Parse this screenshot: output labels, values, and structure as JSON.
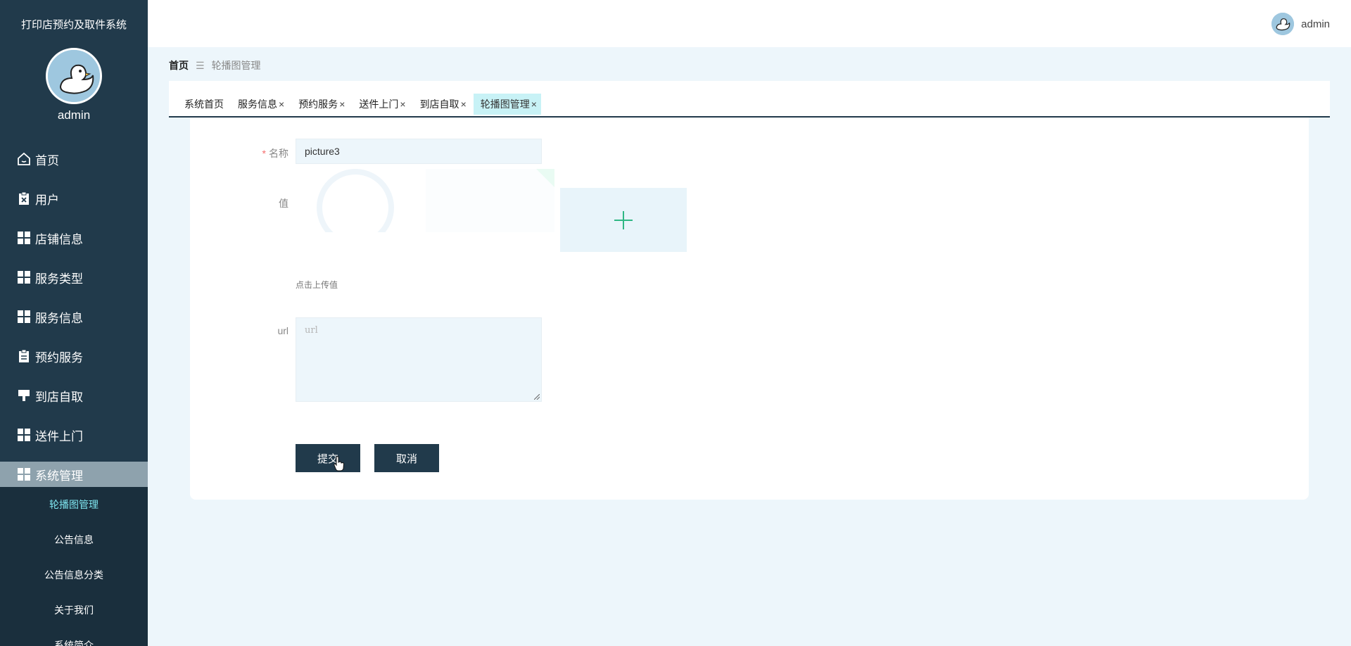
{
  "sidebar": {
    "brand": "打印店预约及取件系统",
    "username": "admin",
    "items": [
      {
        "label": "首页",
        "icon": "home-icon"
      },
      {
        "label": "用户",
        "icon": "clipboard-x-icon"
      },
      {
        "label": "店铺信息",
        "icon": "grid-icon"
      },
      {
        "label": "服务类型",
        "icon": "grid-icon"
      },
      {
        "label": "服务信息",
        "icon": "grid-icon"
      },
      {
        "label": "预约服务",
        "icon": "clipboard-icon"
      },
      {
        "label": "到店自取",
        "icon": "stamp-icon"
      },
      {
        "label": "送件上门",
        "icon": "grid-icon"
      },
      {
        "label": "系统管理",
        "icon": "grid-icon"
      }
    ],
    "submenu": [
      {
        "label": "轮播图管理"
      },
      {
        "label": "公告信息"
      },
      {
        "label": "公告信息分类"
      },
      {
        "label": "关于我们"
      },
      {
        "label": "系统简介"
      }
    ]
  },
  "header": {
    "username": "admin"
  },
  "breadcrumb": {
    "home": "首页",
    "separator": "☰",
    "current": "轮播图管理"
  },
  "tabs": [
    {
      "label": "系统首页",
      "closable": false
    },
    {
      "label": "服务信息",
      "closable": true
    },
    {
      "label": "预约服务",
      "closable": true
    },
    {
      "label": "送件上门",
      "closable": true
    },
    {
      "label": "到店自取",
      "closable": true
    },
    {
      "label": "轮播图管理",
      "closable": true
    }
  ],
  "tab_close_glyph": "×",
  "form": {
    "required_mark": "*",
    "name_label": "名称",
    "name_value": "picture3",
    "value_label": "值",
    "upload_hint": "点击上传值",
    "url_label": "url",
    "url_placeholder": "url",
    "submit_label": "提交",
    "cancel_label": "取消"
  },
  "colors": {
    "sidebar_bg": "#213a4b",
    "active_menu_bg": "#8ea2ad",
    "active_tab_bg": "#c8f2f6",
    "plus_color": "#2fb784"
  }
}
